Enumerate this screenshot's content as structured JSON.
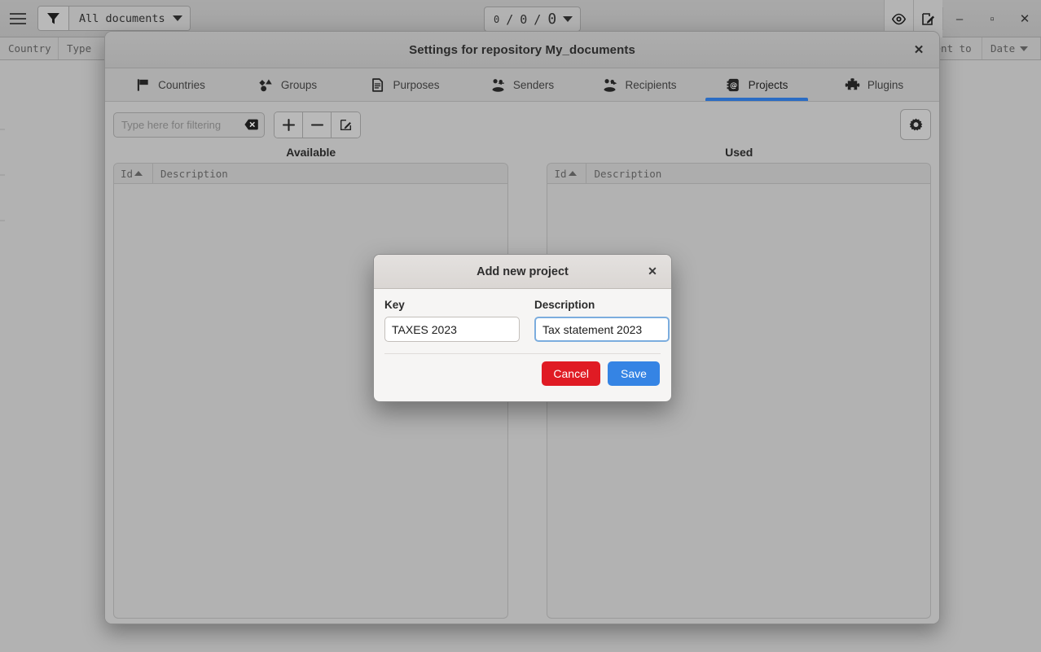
{
  "main_window": {
    "menu_icon": "hamburger-icon",
    "filter_icon": "funnel-icon",
    "filter_label": "All documents",
    "counter": {
      "part1": "0",
      "sep1": "/",
      "part2": "0",
      "sep2": "/",
      "part3": "0"
    },
    "right_icons": [
      "eye-icon",
      "edit-document-icon"
    ],
    "window_controls": {
      "minimize": "–",
      "maximize": "▫",
      "close": "✕"
    },
    "table_columns": [
      "Country",
      "Type",
      "Sent to",
      "Date"
    ],
    "date_sort": "desc"
  },
  "settings_window": {
    "title": "Settings for repository My_documents",
    "close_label": "✕",
    "tabs": [
      {
        "label": "Countries",
        "icon": "flag-icon",
        "active": false
      },
      {
        "label": "Groups",
        "icon": "shapes-icon",
        "active": false
      },
      {
        "label": "Purposes",
        "icon": "document-icon",
        "active": false
      },
      {
        "label": "Senders",
        "icon": "senders-icon",
        "active": false
      },
      {
        "label": "Recipients",
        "icon": "recipients-icon",
        "active": false
      },
      {
        "label": "Projects",
        "icon": "address-book-icon",
        "active": true
      },
      {
        "label": "Plugins",
        "icon": "puzzle-icon",
        "active": false
      }
    ],
    "toolbar": {
      "filter_placeholder": "Type here for filtering",
      "filter_value": "",
      "clear_icon": "clear-icon",
      "add_label": "+",
      "remove_label": "−",
      "edit_icon": "edit-icon",
      "settings_icon": "gear-icon"
    },
    "lists": {
      "available": {
        "caption": "Available",
        "columns": [
          "Id",
          "Description"
        ],
        "sort": "asc",
        "rows": []
      },
      "used": {
        "caption": "Used",
        "columns": [
          "Id",
          "Description"
        ],
        "sort": "asc",
        "rows": []
      },
      "move_button_icon": "chevron-left-icon"
    }
  },
  "add_dialog": {
    "title": "Add new project",
    "close_label": "✕",
    "key_label": "Key",
    "key_value": "TAXES 2023",
    "description_label": "Description",
    "description_value": "Tax statement 2023",
    "cancel_label": "Cancel",
    "save_label": "Save",
    "colors": {
      "cancel": "#e01b24",
      "save": "#3584e4",
      "focus_border": "#7cadde",
      "tab_accent": "#2a6cc4"
    }
  }
}
